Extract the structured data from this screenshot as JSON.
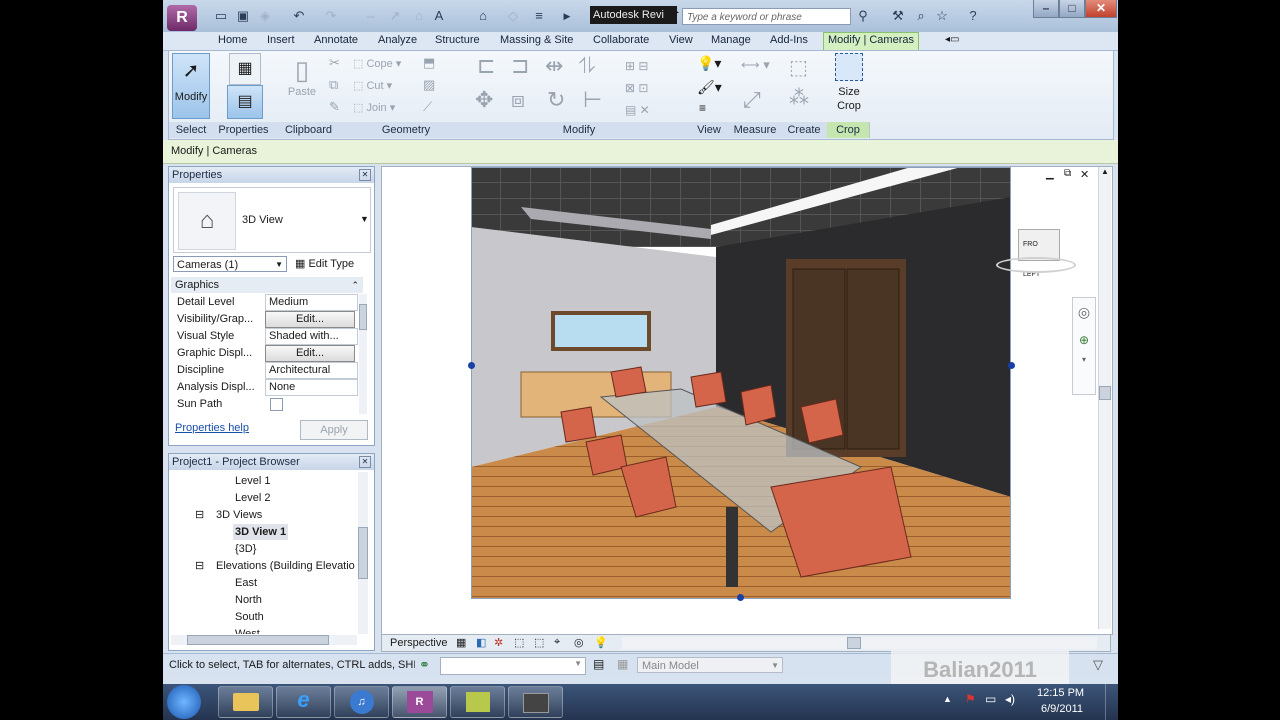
{
  "window": {
    "title": "Autodesk Revi",
    "search_placeholder": "Type a keyword or phrase"
  },
  "tabs": [
    "Home",
    "Insert",
    "Annotate",
    "Analyze",
    "Structure",
    "Massing & Site",
    "Collaborate",
    "View",
    "Manage",
    "Add-Ins",
    "Modify | Cameras"
  ],
  "ribbon": {
    "modify_label": "Modify",
    "paste_label": "Paste",
    "cope_label": "Cope",
    "cut_label": "Cut",
    "join_label": "Join",
    "size_crop_label": "Size Crop",
    "panels": [
      "Select",
      "Properties",
      "Clipboard",
      "Geometry",
      "Modify",
      "View",
      "Measure",
      "Create",
      "Crop"
    ]
  },
  "options_bar": {
    "context": "Modify | Cameras"
  },
  "properties": {
    "header": "Properties",
    "type_name": "3D View",
    "selector": "Cameras (1)",
    "edit_type": "Edit Type",
    "group": "Graphics",
    "rows": [
      {
        "name": "Detail Level",
        "value": "Medium"
      },
      {
        "name": "Visibility/Grap...",
        "value": "Edit..."
      },
      {
        "name": "Visual Style",
        "value": "Shaded with..."
      },
      {
        "name": "Graphic Displ...",
        "value": "Edit..."
      },
      {
        "name": "Discipline",
        "value": "Architectural"
      },
      {
        "name": "Analysis Displ...",
        "value": "None"
      },
      {
        "name": "Sun Path",
        "value": ""
      }
    ],
    "help_link": "Properties help",
    "apply": "Apply"
  },
  "browser": {
    "header": "Project1 - Project Browser",
    "items": [
      "Level 1",
      "Level 2",
      "3D Views",
      "3D View 1",
      "{3D}",
      "Elevations (Building Elevatio",
      "East",
      "North",
      "South",
      "West"
    ]
  },
  "view_control": {
    "mode": "Perspective",
    "cube_front": "FRO",
    "cube_left": "LEFT"
  },
  "status": {
    "hint": "Click to select, TAB for alternates, CTRL adds, SHI",
    "model": "Main Model",
    "watermark": "Balian2011"
  },
  "clock": {
    "time": "12:15 PM",
    "date": "6/9/2011"
  },
  "colors": {
    "active_tab": "#d4f0c0",
    "ribbon_bg": "#e4ebf4",
    "floor": "#c98a4a",
    "chair": "#d4644a",
    "wall": "#2a2a2a",
    "door": "#4a3424"
  }
}
